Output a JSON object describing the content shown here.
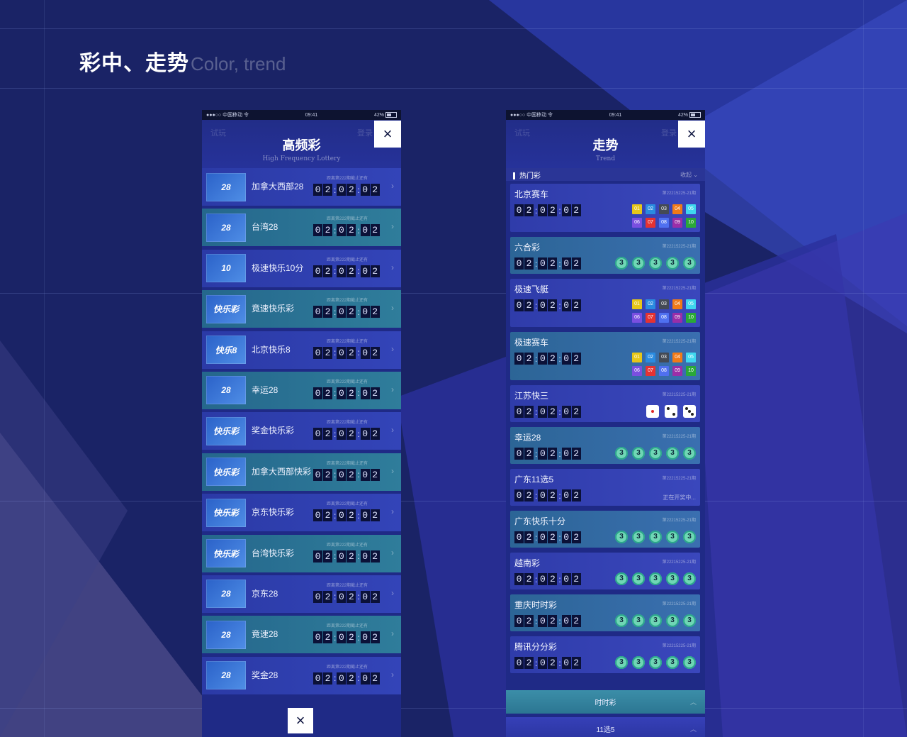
{
  "page": {
    "title_cn": "彩中、走势",
    "title_en": "Color, trend"
  },
  "colors": {
    "background": "#1a2366",
    "card_blue": "#3344b8",
    "card_teal": "#2f7d9b",
    "ball": "#6fd6b5",
    "digit_bg": "#0b1138"
  },
  "status_bar": {
    "carrier": "●●●○○ 中国移动 令",
    "time": "09:41",
    "battery": "42%"
  },
  "timer_digits": [
    "0",
    "2",
    "0",
    "2",
    "0",
    "2"
  ],
  "left_phone": {
    "ghost_left": "试玩",
    "ghost_right": "登录",
    "title": "高频彩",
    "subtitle": "High Frequency Lottery",
    "close_label": "×",
    "item_subtitle": "距离第222期截止还有",
    "items": [
      {
        "name": "加拿大西部28",
        "logo": "28",
        "style": "blue"
      },
      {
        "name": "台湾28",
        "logo": "28",
        "style": "teal"
      },
      {
        "name": "极速快乐10分",
        "logo": "10",
        "style": "blue"
      },
      {
        "name": "竟速快乐彩",
        "logo": "快乐彩",
        "style": "teal"
      },
      {
        "name": "北京快乐8",
        "logo": "快乐8",
        "style": "blue"
      },
      {
        "name": "幸运28",
        "logo": "28",
        "style": "teal"
      },
      {
        "name": "奖金快乐彩",
        "logo": "快乐彩",
        "style": "blue"
      },
      {
        "name": "加拿大西部快彩",
        "logo": "快乐彩",
        "style": "teal"
      },
      {
        "name": "京东快乐彩",
        "logo": "快乐彩",
        "style": "blue"
      },
      {
        "name": "台湾快乐彩",
        "logo": "快乐彩",
        "style": "teal"
      },
      {
        "name": "京东28",
        "logo": "28",
        "style": "blue"
      },
      {
        "name": "竟速28",
        "logo": "28",
        "style": "teal"
      },
      {
        "name": "奖金28",
        "logo": "28",
        "style": "blue"
      }
    ]
  },
  "right_phone": {
    "ghost_left": "试玩",
    "ghost_right": "登录",
    "title": "走势",
    "subtitle": "Trend",
    "close_label": "×",
    "category": "热门彩",
    "category_right": "收起 ⌄",
    "period": "第22215225-21期",
    "square_numbers": [
      "01",
      "02",
      "03",
      "04",
      "05",
      "06",
      "07",
      "08",
      "09",
      "10"
    ],
    "square_colors": [
      "#e6c619",
      "#2a8be0",
      "#444a55",
      "#f07a18",
      "#3fd7ee",
      "#7a4fe0",
      "#e53232",
      "#4f70f0",
      "#9a2ea8",
      "#2aa838"
    ],
    "ball_values": [
      "3",
      "3",
      "3",
      "3",
      "3"
    ],
    "items": [
      {
        "name": "北京赛车",
        "type": "squares",
        "style": "blue"
      },
      {
        "name": "六合彩",
        "type": "balls",
        "style": "teal"
      },
      {
        "name": "极速飞艇",
        "type": "squares",
        "style": "blue"
      },
      {
        "name": "极速赛车",
        "type": "squares",
        "style": "teal"
      },
      {
        "name": "江苏快三",
        "type": "dice",
        "style": "blue"
      },
      {
        "name": "幸运28",
        "type": "balls",
        "style": "teal"
      },
      {
        "name": "广东11选5",
        "type": "status",
        "style": "blue",
        "status": "正在开奖中..."
      },
      {
        "name": "广东快乐十分",
        "type": "balls",
        "style": "teal"
      },
      {
        "name": "越南彩",
        "type": "balls",
        "style": "blue"
      },
      {
        "name": "重庆时时彩",
        "type": "balls",
        "style": "teal"
      },
      {
        "name": "腾讯分分彩",
        "type": "balls",
        "style": "blue"
      }
    ],
    "bottom_tabs": [
      {
        "label": "时时彩"
      },
      {
        "label": "11选5"
      }
    ]
  }
}
